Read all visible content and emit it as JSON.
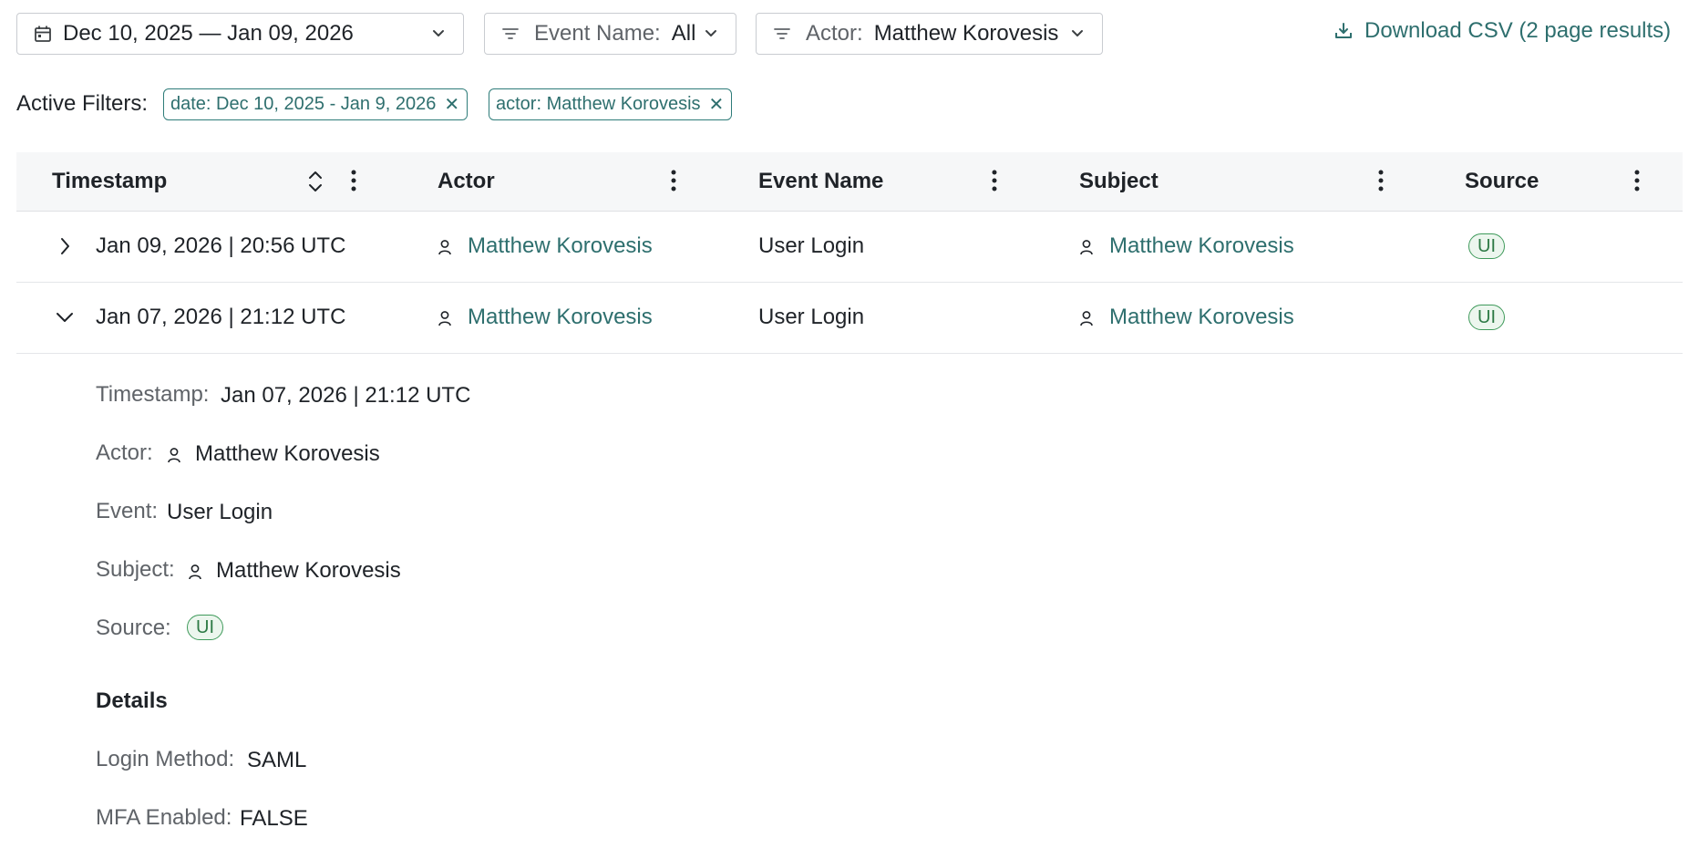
{
  "toolbar": {
    "date_range": "Dec 10, 2025 — Jan 09, 2026",
    "event_filter": {
      "label": "Event Name:",
      "value": "All"
    },
    "actor_filter": {
      "label": "Actor:",
      "value": "Matthew Korovesis"
    },
    "download_label": "Download CSV (2 page results)"
  },
  "active_filters": {
    "label": "Active Filters:",
    "chips": [
      {
        "text": "date: Dec 10, 2025 - Jan 9, 2026"
      },
      {
        "text": "actor: Matthew Korovesis"
      }
    ]
  },
  "table": {
    "columns": [
      "Timestamp",
      "Actor",
      "Event Name",
      "Subject",
      "Source"
    ],
    "rows": [
      {
        "timestamp": "Jan 09, 2026 | 20:56 UTC",
        "actor": "Matthew Korovesis",
        "event": "User Login",
        "subject": "Matthew Korovesis",
        "source": "UI",
        "expanded": false
      },
      {
        "timestamp": "Jan 07, 2026 | 21:12 UTC",
        "actor": "Matthew Korovesis",
        "event": "User Login",
        "subject": "Matthew Korovesis",
        "source": "UI",
        "expanded": true
      }
    ]
  },
  "detail": {
    "timestamp_label": "Timestamp:",
    "timestamp": "Jan 07, 2026 | 21:12 UTC",
    "actor_label": "Actor:",
    "actor": "Matthew Korovesis",
    "event_label": "Event:",
    "event": "User Login",
    "subject_label": "Subject:",
    "subject": "Matthew Korovesis",
    "source_label": "Source:",
    "source": "UI",
    "details_heading": "Details",
    "login_method_label": "Login Method:",
    "login_method": "SAML",
    "mfa_label": "MFA Enabled:",
    "mfa": "FALSE"
  },
  "colors": {
    "accent": "#2e6f6e",
    "badge_border": "#3f9a5b",
    "badge_bg": "#ecf6ee",
    "header_bg": "#f6f7f8"
  }
}
